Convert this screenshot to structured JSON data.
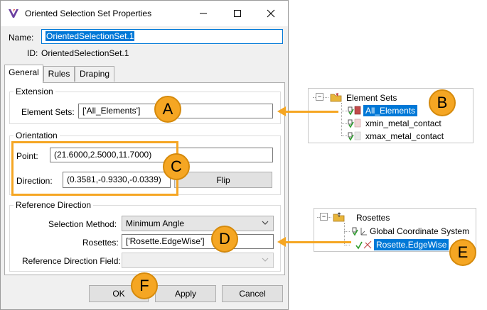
{
  "window": {
    "title": "Oriented Selection Set Properties",
    "minimize_symbol": "─",
    "maximize_symbol": "☐",
    "close_symbol": "✕"
  },
  "name_label": "Name:",
  "name_value": "OrientedSelectionSet.1",
  "id_label": "ID:",
  "id_value": "OrientedSelectionSet.1",
  "tabs": [
    {
      "label": "General",
      "active": true
    },
    {
      "label": "Rules",
      "active": false
    },
    {
      "label": "Draping",
      "active": false
    }
  ],
  "extension": {
    "title": "Extension",
    "element_sets_label": "Element Sets:",
    "element_sets_value": "['All_Elements']"
  },
  "orientation": {
    "title": "Orientation",
    "point_label": "Point:",
    "point_value": "(21.6000,2.5000,11.7000)",
    "direction_label": "Direction:",
    "direction_value": "(0.3581,-0.9330,-0.0339)",
    "flip_label": "Flip"
  },
  "reference_direction": {
    "title": "Reference Direction",
    "selection_method_label": "Selection Method:",
    "selection_method_value": "Minimum Angle",
    "rosettes_label": "Rosettes:",
    "rosettes_value": "['Rosette.EdgeWise']",
    "field_label": "Reference Direction Field:",
    "field_value": ""
  },
  "buttons": {
    "ok": "OK",
    "apply": "Apply",
    "cancel": "Cancel"
  },
  "callouts": {
    "a": "A",
    "b": "B",
    "c": "C",
    "d": "D",
    "e": "E",
    "f": "F"
  },
  "element_sets_tree": {
    "root": "Element Sets",
    "items": [
      {
        "label": "All_Elements",
        "selected": true
      },
      {
        "label": "xmin_metal_contact",
        "selected": false
      },
      {
        "label": "xmax_metal_contact",
        "selected": false
      }
    ]
  },
  "rosettes_tree": {
    "root": "Rosettes",
    "items": [
      {
        "label": "Global Coordinate System",
        "selected": false
      },
      {
        "label": "Rosette.EdgeWise",
        "selected": true
      }
    ]
  },
  "colors": {
    "accent": "#0078d7",
    "callout": "#f5a623",
    "highlight_box": "#f5a623",
    "check_green": "#2e9e2e"
  }
}
